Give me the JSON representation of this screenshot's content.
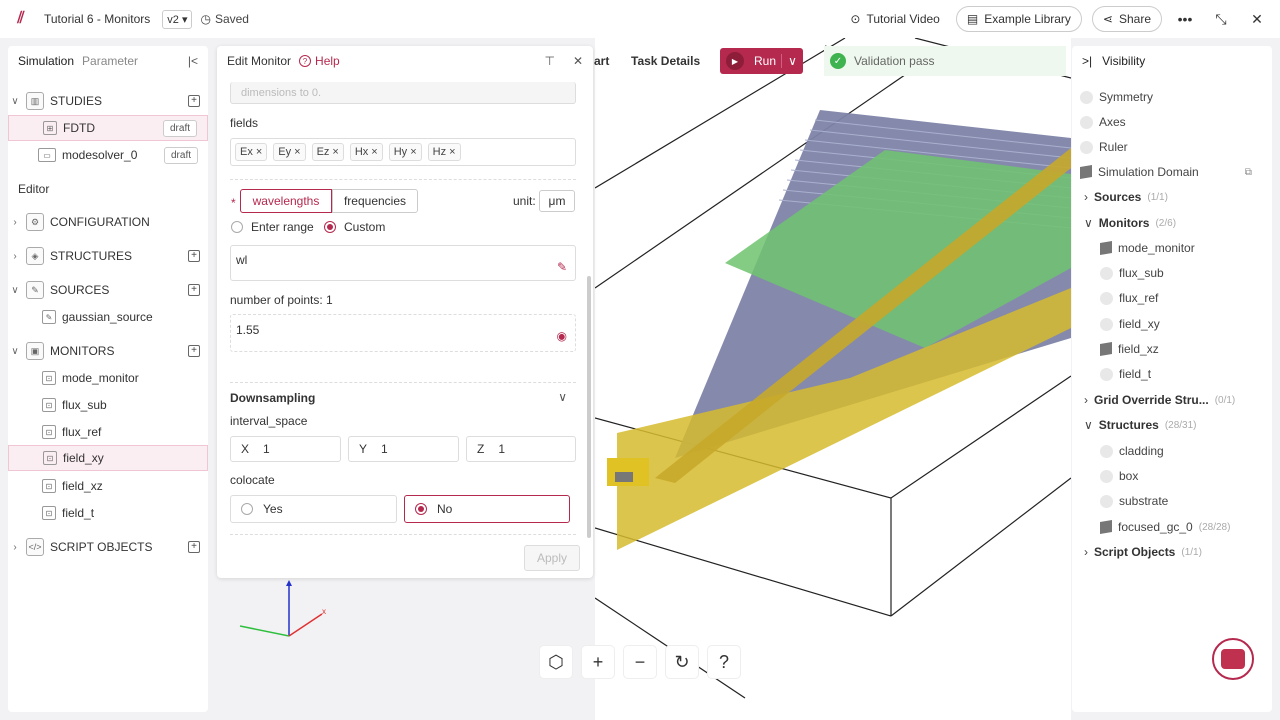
{
  "app": {
    "title": "Tutorial 6 - Monitors",
    "version": "v2",
    "saved": "Saved",
    "tutorial_video": "Tutorial Video",
    "example_library": "Example Library",
    "share": "Share",
    "accent": "#b5294e"
  },
  "left": {
    "tab_simulation": "Simulation",
    "tab_parameter": "Parameter",
    "studies": "STUDIES",
    "fdtd": "FDTD",
    "modesolver": "modesolver_0",
    "draft": "draft",
    "editor": "Editor",
    "configuration": "CONFIGURATION",
    "structures": "STRUCTURES",
    "sources": "SOURCES",
    "gaussian_source": "gaussian_source",
    "monitors": "MONITORS",
    "monitor_items": [
      "mode_monitor",
      "flux_sub",
      "flux_ref",
      "field_xy",
      "field_xz",
      "field_t"
    ],
    "script_objects": "SCRIPT OBJECTS"
  },
  "edit": {
    "title": "Edit Monitor",
    "help": "Help",
    "dims_placeholder": "dimensions to 0.",
    "fields_label": "fields",
    "fields": [
      "Ex",
      "Ey",
      "Ez",
      "Hx",
      "Hy",
      "Hz"
    ],
    "wavelengths": "wavelengths",
    "frequencies": "frequencies",
    "unit_label": "unit:",
    "unit": "μm",
    "enter_range": "Enter range",
    "custom": "Custom",
    "wl_value": "wl",
    "num_points": "number of points: 1",
    "points_value": "1.55",
    "downsampling": "Downsampling",
    "interval_space": "interval_space",
    "x_label": "X",
    "x_value": "1",
    "y_label": "Y",
    "y_value": "1",
    "z_label": "Z",
    "z_value": "1",
    "colocate": "colocate",
    "yes": "Yes",
    "no": "No",
    "apply": "Apply"
  },
  "toolbar": {
    "start_partial": "art",
    "task_details": "Task Details",
    "run": "Run",
    "validation": "Validation pass"
  },
  "visibility": {
    "title": "Visibility",
    "symmetry": "Symmetry",
    "axes": "Axes",
    "ruler": "Ruler",
    "simulation_domain": "Simulation Domain",
    "sources": "Sources",
    "sources_count": "(1/1)",
    "monitors": "Monitors",
    "monitors_count": "(2/6)",
    "monitor_items": [
      "mode_monitor",
      "flux_sub",
      "flux_ref",
      "field_xy",
      "field_xz",
      "field_t"
    ],
    "grid_override": "Grid Override Stru...",
    "grid_count": "(0/1)",
    "structures": "Structures",
    "structures_count": "(28/31)",
    "structure_items": [
      "cladding",
      "box",
      "substrate",
      "focused_gc_0"
    ],
    "focused_count": "(28/28)",
    "script_objects": "Script Objects",
    "script_count": "(1/1)"
  }
}
